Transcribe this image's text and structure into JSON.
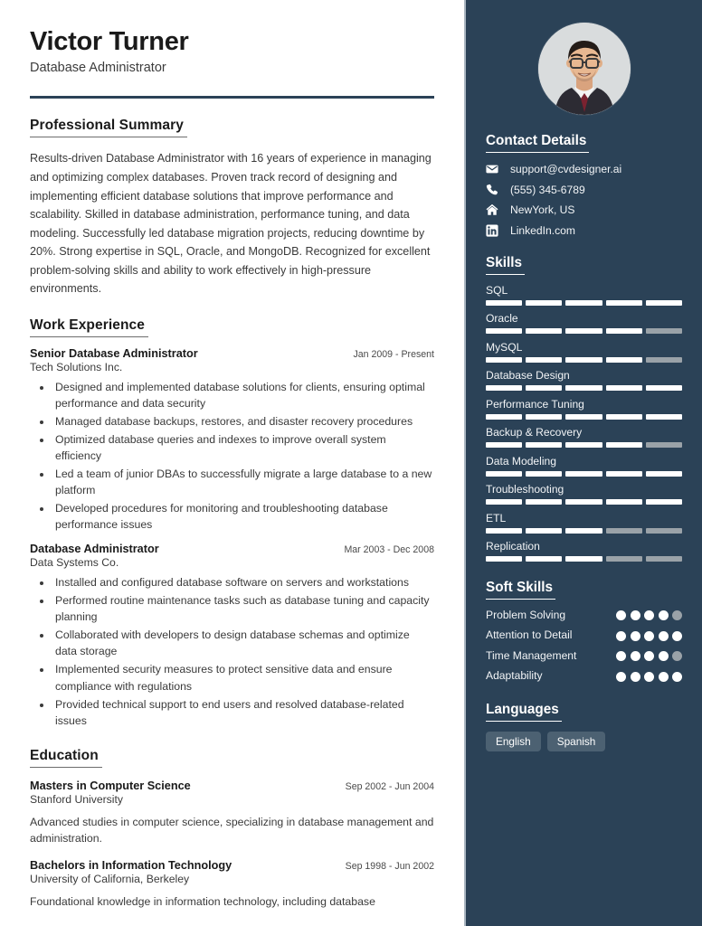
{
  "colors": {
    "sidebar_bg": "#2b4257",
    "sidebar_border": "#aab6c1",
    "header_rule": "#2b4257",
    "skill_filled": "#ffffff",
    "skill_empty": "#9aa2a8",
    "chip_bg": "#4c6172",
    "body_text": "#3a3a3a",
    "heading_text": "#1a1a1a"
  },
  "header": {
    "name": "Victor Turner",
    "job_title": "Database Administrator"
  },
  "summary": {
    "title": "Professional Summary",
    "text": "Results-driven Database Administrator with 16 years of experience in managing and optimizing complex databases. Proven track record of designing and implementing efficient database solutions that improve performance and scalability. Skilled in database administration, performance tuning, and data modeling. Successfully led database migration projects, reducing downtime by 20%. Strong expertise in SQL, Oracle, and MongoDB. Recognized for excellent problem-solving skills and ability to work effectively in high-pressure environments."
  },
  "work_experience": {
    "title": "Work Experience",
    "entries": [
      {
        "role": "Senior Database Administrator",
        "date": "Jan 2009 - Present",
        "organization": "Tech Solutions Inc.",
        "bullets": [
          "Designed and implemented database solutions for clients, ensuring optimal performance and data security",
          "Managed database backups, restores, and disaster recovery procedures",
          "Optimized database queries and indexes to improve overall system efficiency",
          "Led a team of junior DBAs to successfully migrate a large database to a new platform",
          "Developed procedures for monitoring and troubleshooting database performance issues"
        ]
      },
      {
        "role": "Database Administrator",
        "date": "Mar 2003 - Dec 2008",
        "organization": "Data Systems Co.",
        "bullets": [
          "Installed and configured database software on servers and workstations",
          "Performed routine maintenance tasks such as database tuning and capacity planning",
          "Collaborated with developers to design database schemas and optimize data storage",
          "Implemented security measures to protect sensitive data and ensure compliance with regulations",
          "Provided technical support to end users and resolved database-related issues"
        ]
      }
    ]
  },
  "education": {
    "title": "Education",
    "entries": [
      {
        "degree": "Masters in Computer Science",
        "date": "Sep 2002 - Jun 2004",
        "school": "Stanford University",
        "description": "Advanced studies in computer science, specializing in database management and administration."
      },
      {
        "degree": "Bachelors in Information Technology",
        "date": "Sep 1998 - Jun 2002",
        "school": "University of California, Berkeley",
        "description": "Foundational knowledge in information technology, including database"
      }
    ]
  },
  "sidebar": {
    "photo_alt": "profile-photo",
    "contact": {
      "title": "Contact Details",
      "items": [
        {
          "icon": "envelope-icon",
          "value": "support@cvdesigner.ai"
        },
        {
          "icon": "phone-icon",
          "value": "(555) 345-6789"
        },
        {
          "icon": "home-icon",
          "value": "NewYork, US"
        },
        {
          "icon": "linkedin-icon",
          "value": "LinkedIn.com"
        }
      ]
    },
    "skills": {
      "title": "Skills",
      "max": 5,
      "items": [
        {
          "label": "SQL",
          "level": 5
        },
        {
          "label": "Oracle",
          "level": 4
        },
        {
          "label": "MySQL",
          "level": 4
        },
        {
          "label": "Database Design",
          "level": 5
        },
        {
          "label": "Performance Tuning",
          "level": 5
        },
        {
          "label": "Backup & Recovery",
          "level": 4
        },
        {
          "label": "Data Modeling",
          "level": 5
        },
        {
          "label": "Troubleshooting",
          "level": 5
        },
        {
          "label": "ETL",
          "level": 3
        },
        {
          "label": "Replication",
          "level": 3
        }
      ]
    },
    "soft_skills": {
      "title": "Soft Skills",
      "max": 5,
      "items": [
        {
          "label": "Problem Solving",
          "level": 4
        },
        {
          "label": "Attention to Detail",
          "level": 5
        },
        {
          "label": "Time Management",
          "level": 4
        },
        {
          "label": "Adaptability",
          "level": 5
        }
      ]
    },
    "languages": {
      "title": "Languages",
      "items": [
        "English",
        "Spanish"
      ]
    }
  }
}
